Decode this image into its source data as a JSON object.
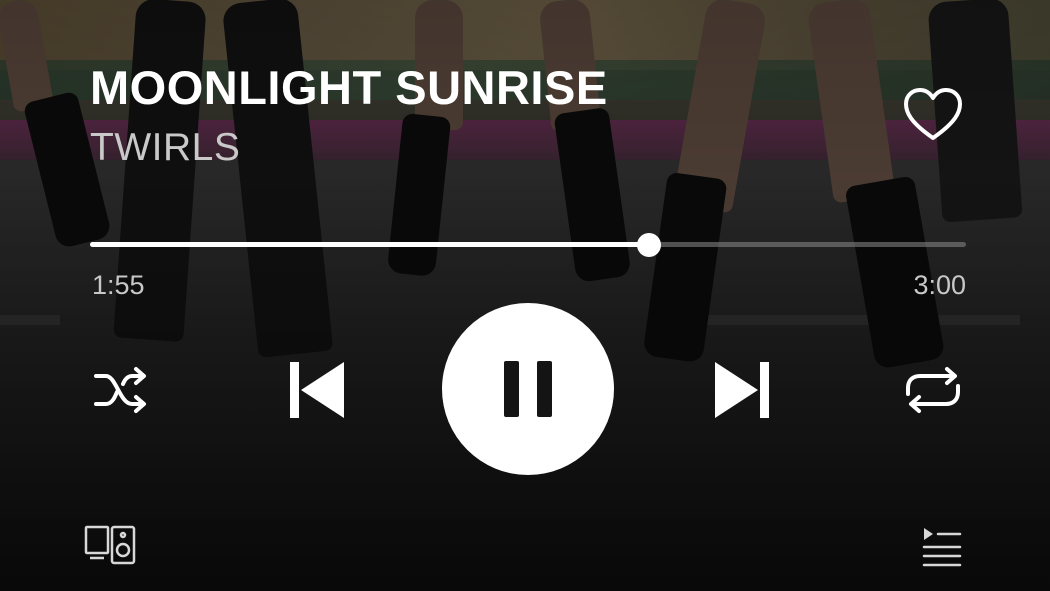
{
  "track": {
    "title": "MOONLIGHT SUNRISE",
    "artist": "TWIRLS",
    "liked": false
  },
  "playback": {
    "elapsed": "1:55",
    "duration": "3:00",
    "progress_fraction": 0.638,
    "state": "playing"
  },
  "controls": {
    "shuffle_icon": "shuffle-icon",
    "previous_icon": "skip-previous-icon",
    "pause_icon": "pause-icon",
    "next_icon": "skip-next-icon",
    "repeat_icon": "repeat-icon",
    "heart_icon": "heart-outline-icon",
    "devices_icon": "connect-devices-icon",
    "queue_icon": "queue-icon"
  },
  "colors": {
    "primary": "#ffffff",
    "secondary_text": "#c8c8c8",
    "track_background": "#8c8c8c"
  }
}
